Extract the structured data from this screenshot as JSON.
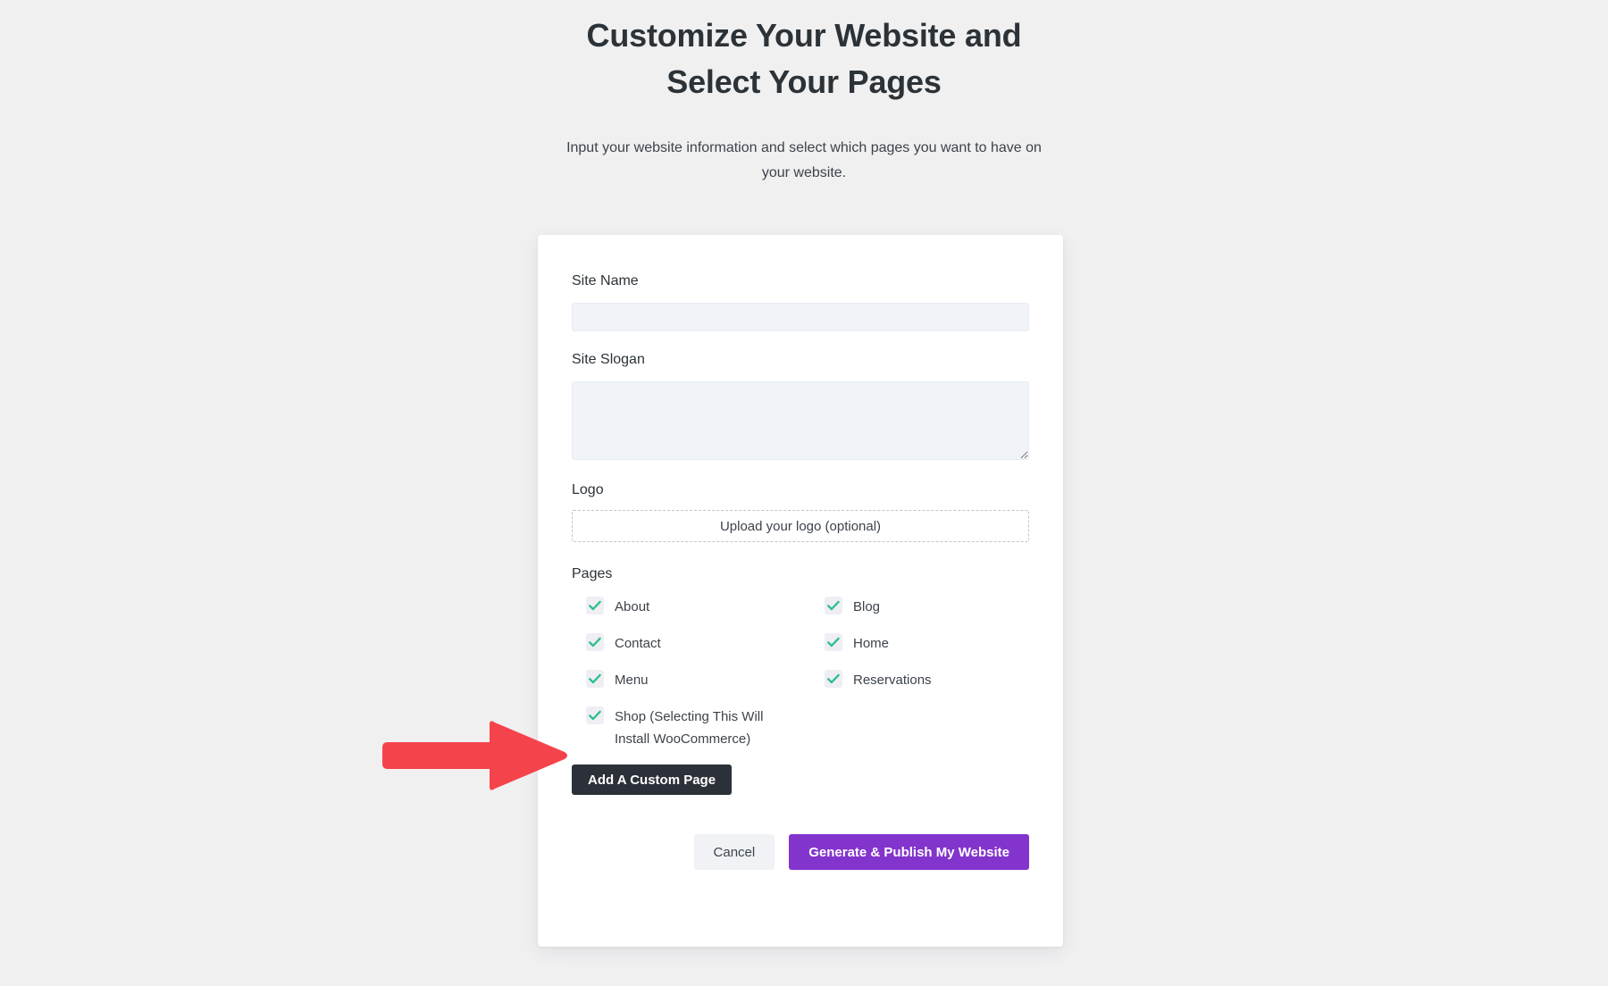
{
  "header": {
    "title": "Customize Your Website and Select Your Pages",
    "subtitle": "Input your website information and select which pages you want to have on your website."
  },
  "form": {
    "site_name": {
      "label": "Site Name",
      "value": "",
      "placeholder": ""
    },
    "site_slogan": {
      "label": "Site Slogan",
      "value": "",
      "placeholder": ""
    },
    "logo": {
      "label": "Logo",
      "upload_text": "Upload your logo (optional)"
    },
    "pages": {
      "label": "Pages",
      "items": [
        {
          "label": "About",
          "checked": true
        },
        {
          "label": "Blog",
          "checked": true
        },
        {
          "label": "Contact",
          "checked": true
        },
        {
          "label": "Home",
          "checked": true
        },
        {
          "label": "Menu",
          "checked": true
        },
        {
          "label": "Reservations",
          "checked": true
        },
        {
          "label": "Shop (Selecting This Will Install WooCommerce)",
          "checked": true
        }
      ]
    },
    "add_custom_page_label": "Add A Custom Page"
  },
  "actions": {
    "cancel_label": "Cancel",
    "publish_label": "Generate & Publish My Website"
  },
  "colors": {
    "page_background": "#f0f0f1",
    "card_background": "#ffffff",
    "input_background": "#f0f3f7",
    "checkbox_background": "#eeeef4",
    "checkmark": "#2bbf8e",
    "dark_button": "#2c3038",
    "primary_button": "#8334cc",
    "cancel_button": "#f0f2f5",
    "annotation_arrow": "#f5434c",
    "title_text": "#2c3338",
    "body_text": "#3c434a"
  },
  "annotation": {
    "arrow_icon": "arrow-right-icon",
    "points_at": "Shop (Selecting This Will Install WooCommerce)"
  }
}
